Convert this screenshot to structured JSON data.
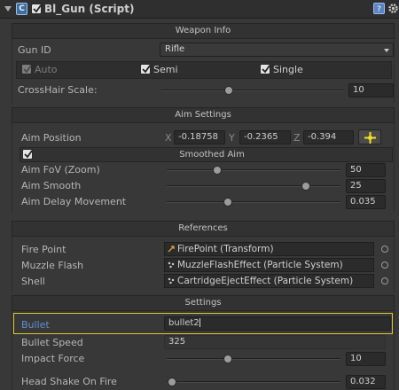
{
  "header": {
    "title": "Bl_Gun (Script)"
  },
  "sections": {
    "weapon_info": "Weapon Info",
    "aim_settings": "Aim Settings",
    "smoothed_aim": "Smoothed Aim",
    "references": "References",
    "settings": "Settings"
  },
  "weapon_info": {
    "gun_id_label": "Gun ID",
    "gun_id_value": "Rifle",
    "auto_label": "Auto",
    "semi_label": "Semi",
    "single_label": "Single",
    "crosshair_label": "CrossHair Scale:",
    "crosshair_value": "10",
    "crosshair_fill": 0.37
  },
  "aim": {
    "position_label": "Aim Position",
    "x_label": "X",
    "x_value": "-0.18758",
    "y_label": "Y",
    "y_value": "-0.2365",
    "z_label": "Z",
    "z_value": "-0.394",
    "fov_label": "Aim FoV (Zoom)",
    "fov_value": "50",
    "fov_fill": 0.29,
    "smooth_label": "Aim Smooth",
    "smooth_value": "25",
    "smooth_fill": 0.8,
    "delay_label": "Aim Delay Movement",
    "delay_value": "0.035",
    "delay_fill": 0.35
  },
  "references": {
    "fire_point_label": "Fire Point",
    "fire_point_value": "FirePoint (Transform)",
    "muzzle_label": "Muzzle Flash",
    "muzzle_value": "MuzzleFlashEffect (Particle System)",
    "shell_label": "Shell",
    "shell_value": "CartridgeEjectEffect (Particle System)"
  },
  "settings": {
    "bullet_label": "Bullet",
    "bullet_value": "bullet2",
    "speed_label": "Bullet Speed",
    "speed_value": "325",
    "impact_label": "Impact Force",
    "impact_value": "10",
    "impact_fill": 0.35,
    "shake_label": "Head Shake On Fire",
    "shake_value": "0.032",
    "shake_fill": 0.03
  },
  "colors": {
    "highlight": "#d9c72a",
    "bullet_label": "#5e8fd9",
    "crosshair_button": "#f2e21c"
  }
}
